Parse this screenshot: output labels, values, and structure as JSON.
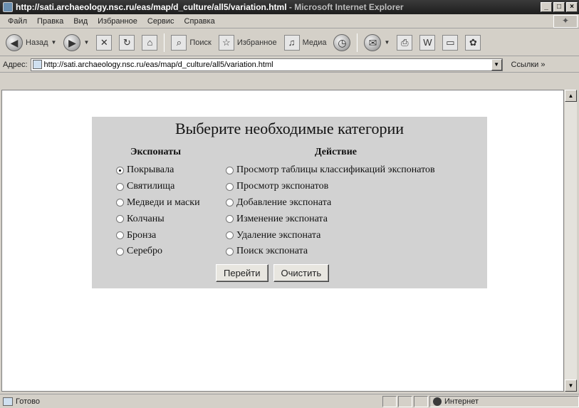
{
  "window": {
    "title_url": "http://sati.archaeology.nsc.ru/eas/map/d_culture/all5/variation.html",
    "title_app": " - Microsoft Internet Explorer"
  },
  "menu": [
    "Файл",
    "Правка",
    "Вид",
    "Избранное",
    "Сервис",
    "Справка"
  ],
  "toolbar": {
    "back_label": "Назад",
    "search_label": "Поиск",
    "favorites_label": "Избранное",
    "media_label": "Медиа"
  },
  "address": {
    "label": "Адрес:",
    "value": "http://sati.archaeology.nsc.ru/eas/map/d_culture/all5/variation.html",
    "links_label": "Ссылки »"
  },
  "form": {
    "title": "Выберите необходимые категории",
    "exhibits_header": "Экспонаты",
    "action_header": "Действие",
    "exhibits": [
      {
        "label": "Покрывала",
        "checked": true
      },
      {
        "label": "Святилища",
        "checked": false
      },
      {
        "label": "Медведи и маски",
        "checked": false
      },
      {
        "label": "Колчаны",
        "checked": false
      },
      {
        "label": "Бронза",
        "checked": false
      },
      {
        "label": "Серебро",
        "checked": false
      }
    ],
    "actions": [
      {
        "label": "Просмотр таблицы классификаций экспонатов",
        "checked": false
      },
      {
        "label": "Просмотр экспонатов",
        "checked": false
      },
      {
        "label": "Добавление экспоната",
        "checked": false
      },
      {
        "label": "Изменение экспоната",
        "checked": false
      },
      {
        "label": "Удаление экспоната",
        "checked": false
      },
      {
        "label": "Поиск экспоната",
        "checked": false
      }
    ],
    "submit_label": "Перейти",
    "reset_label": "Очистить"
  },
  "status": {
    "text": "Готово",
    "zone": "Интернет"
  }
}
